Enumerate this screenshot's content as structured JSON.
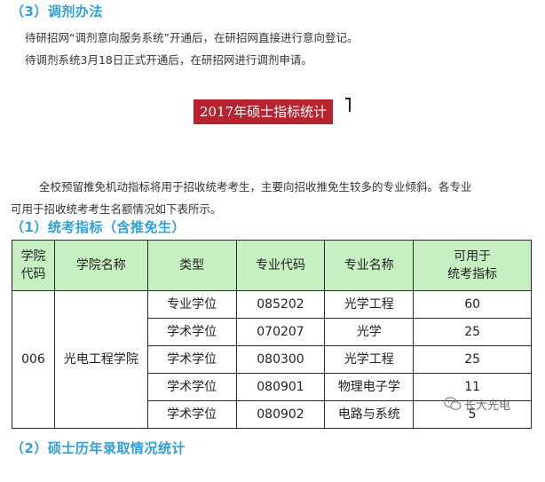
{
  "section3": {
    "title": "（3）调剂办法",
    "line1": "待研招网“调剂意向服务系统”开通后，在研招网直接进行意向登记。",
    "line2": "待调剂系统3月18日正式开通后，在研招网进行调剂申请。"
  },
  "banner": {
    "text": "2017年硕士指标统计"
  },
  "intro": {
    "line1": "全校预留推免机动指标将用于招收统考考生，主要向招收推免生较多的专业倾斜。各专业",
    "line2": "可用于招收统考考生名额情况如下表所示。"
  },
  "section1": {
    "title": "（1）统考指标（含推免生）"
  },
  "table": {
    "headers": [
      "学院\n代码",
      "学院名称",
      "类型",
      "专业代码",
      "专业名称",
      "可用于\n统考指标"
    ],
    "college_code": "006",
    "college_name": "光电工程学院",
    "rows": [
      {
        "type": "专业学位",
        "major_code": "085202",
        "major_name": "光学工程",
        "quota": "60"
      },
      {
        "type": "学术学位",
        "major_code": "070207",
        "major_name": "光学",
        "quota": "25"
      },
      {
        "type": "学术学位",
        "major_code": "080300",
        "major_name": "光学工程",
        "quota": "25"
      },
      {
        "type": "学术学位",
        "major_code": "080901",
        "major_name": "物理电子学",
        "quota": "11"
      },
      {
        "type": "学术学位",
        "major_code": "080902",
        "major_name": "电路与系统",
        "quota": "5"
      }
    ]
  },
  "watermark": {
    "text": "长大光电",
    "icon": "wechat-icon"
  },
  "section2": {
    "title": "（2）硕士历年录取情况统计"
  }
}
